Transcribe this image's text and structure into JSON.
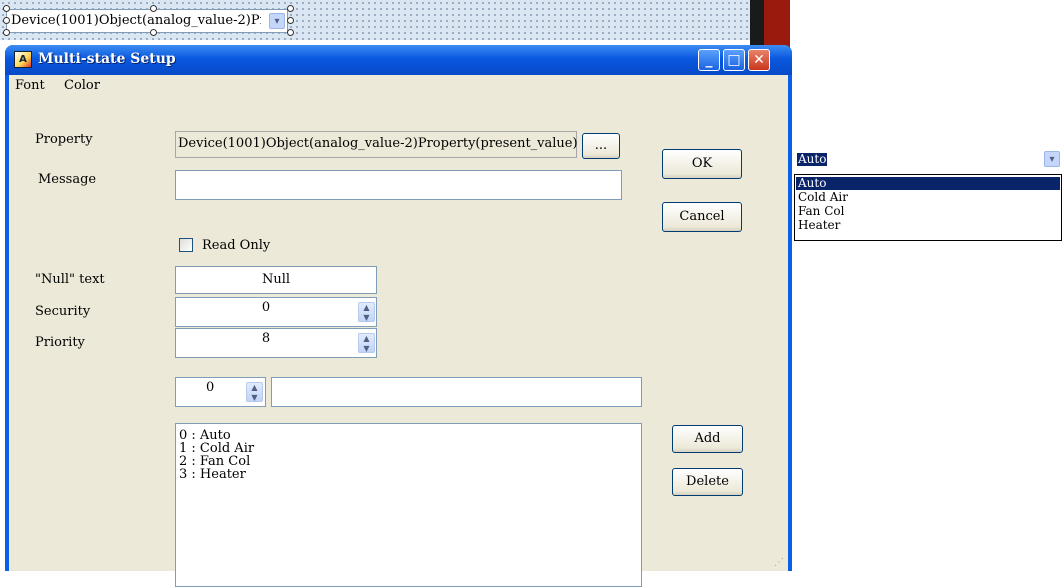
{
  "canvas": {
    "combo_text": "Device(1001)Object(analog_value-2)Pr",
    "combo_arrow": "▾"
  },
  "dialog": {
    "title": "Multi-state Setup",
    "title_buttons": {
      "minimize": "_",
      "maximize": "□",
      "close": "✕"
    },
    "menu": [
      "Font",
      "Color"
    ],
    "labels": {
      "property": "Property",
      "message": "Message",
      "null_text": "\"Null\" text",
      "security": "Security",
      "priority": "Priority"
    },
    "property_value": "Device(1001)Object(analog_value-2)Property(present_value)",
    "browse_label": "...",
    "message_value": "",
    "read_only_label": "Read Only",
    "read_only_checked": false,
    "null_text_value": "Null",
    "security_value": "0",
    "priority_value": "8",
    "state_index": "0",
    "state_text": "",
    "buttons": {
      "ok": "OK",
      "cancel": "Cancel",
      "add": "Add",
      "delete": "Delete"
    },
    "states": [
      "0 : Auto",
      "1 : Cold Air",
      "2 : Fan Col",
      "3 : Heater"
    ]
  },
  "dropdown": {
    "selected": "Auto",
    "options": [
      "Auto",
      "Cold Air",
      "Fan Col",
      "Heater"
    ]
  },
  "colors": {
    "titlebar": "#0a58df",
    "dialog_bg": "#ece9d8",
    "selection": "#0a246a"
  }
}
